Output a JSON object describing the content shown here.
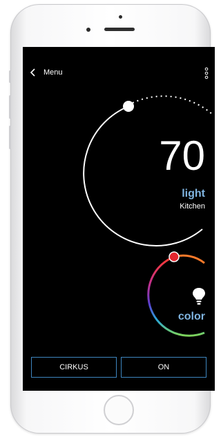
{
  "header": {
    "back_label": "Menu"
  },
  "dial": {
    "value": "70",
    "mode_label": "light",
    "room_label": "Kitchen"
  },
  "color_picker": {
    "label": "color"
  },
  "buttons": {
    "scene_label": "CIRKUS",
    "power_label": "ON"
  },
  "colors": {
    "accent": "#7fb4e0",
    "button_border": "#3e86c0",
    "screen_bg": "#000000",
    "knob_color": "#e4262f"
  },
  "icons": [
    "chevron-left-icon",
    "more-vertical-icon",
    "lightbulb-icon"
  ]
}
